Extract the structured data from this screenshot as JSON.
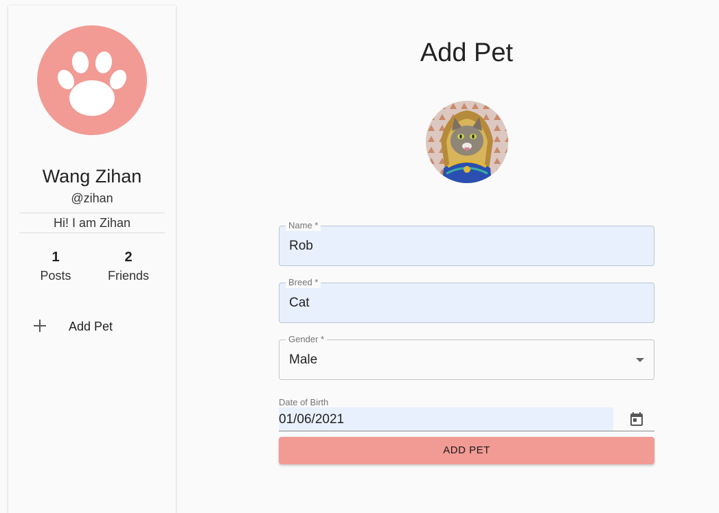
{
  "profile": {
    "avatar_icon": "paw-icon",
    "name": "Wang Zihan",
    "handle": "@zihan",
    "bio": "Hi! I am Zihan",
    "stats": [
      {
        "value": "1",
        "label": "Posts"
      },
      {
        "value": "2",
        "label": "Friends"
      }
    ]
  },
  "sidebar": {
    "add_pet_label": "Add Pet",
    "add_pet_icon": "plus-icon"
  },
  "form": {
    "title": "Add Pet",
    "photo_icon": "pet-photo-cat",
    "name_label": "Name *",
    "name_value": "Rob",
    "breed_label": "Breed *",
    "breed_value": "Cat",
    "gender_label": "Gender *",
    "gender_value": "Male",
    "dob_label": "Date of Birth",
    "dob_value": "01/06/2021",
    "dob_icon": "calendar-icon",
    "submit_label": "ADD PET"
  },
  "colors": {
    "accent": "#f29a94",
    "autofill": "#e8f0fe",
    "background": "#fafafa"
  }
}
